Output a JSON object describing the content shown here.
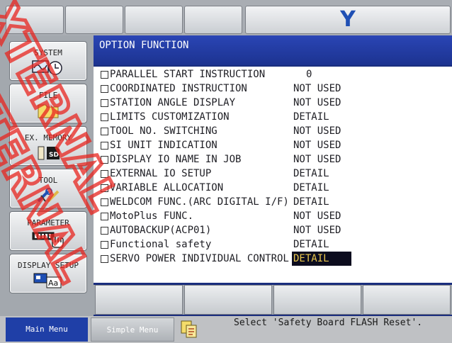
{
  "header": {
    "logo_letter": "Y"
  },
  "main_menu": [
    {
      "label": "SYSTEM",
      "icon": "clock-icon"
    },
    {
      "label": "FILE",
      "icon": "folder-icon"
    },
    {
      "label": "EX. MEMORY",
      "icon": "sd-card-icon"
    },
    {
      "label": "TOOL",
      "icon": "tool-icon"
    },
    {
      "label": "PARAMETER",
      "icon": "parameter-icon"
    },
    {
      "label": "DISPLAY SETUP",
      "icon": "display-setup-icon"
    }
  ],
  "screen": {
    "title": "OPTION FUNCTION",
    "rows": [
      {
        "label": "PARALLEL START INSTRUCTION",
        "value": "0"
      },
      {
        "label": "COORDINATED INSTRUCTION",
        "value": "NOT USED"
      },
      {
        "label": "STATION ANGLE DISPLAY",
        "value": "NOT USED"
      },
      {
        "label": "LIMITS CUSTOMIZATION",
        "value": "DETAIL"
      },
      {
        "label": "TOOL NO. SWITCHING",
        "value": "NOT USED"
      },
      {
        "label": "SI UNIT INDICATION",
        "value": "NOT USED"
      },
      {
        "label": "DISPLAY IO NAME IN JOB",
        "value": "NOT USED"
      },
      {
        "label": "EXTERNAL IO SETUP",
        "value": "DETAIL"
      },
      {
        "label": "VARIABLE ALLOCATION",
        "value": "DETAIL"
      },
      {
        "label": "WELDCOM FUNC.(ARC DIGITAL I/F)",
        "value": "DETAIL"
      },
      {
        "label": "MotoPlus FUNC.",
        "value": "NOT USED"
      },
      {
        "label": "AUTOBACKUP(ACP01)",
        "value": "NOT USED"
      },
      {
        "label": "Functional safety",
        "value": "DETAIL"
      },
      {
        "label": "SERVO POWER INDIVIDUAL CONTROL",
        "value": "DETAIL",
        "selected": true
      }
    ]
  },
  "footer": {
    "main_menu_label": "Main Menu",
    "simple_menu_label": "Simple Menu",
    "status_message": "Select 'Safety Board FLASH Reset'."
  },
  "watermark": {
    "text": "XTERNAL"
  },
  "colors": {
    "title_bar": "#1c3390",
    "selection_bg": "#0c0c1e",
    "selection_fg": "#e9c64d",
    "logo": "#1f4fb4",
    "watermark": "#e8251f"
  }
}
